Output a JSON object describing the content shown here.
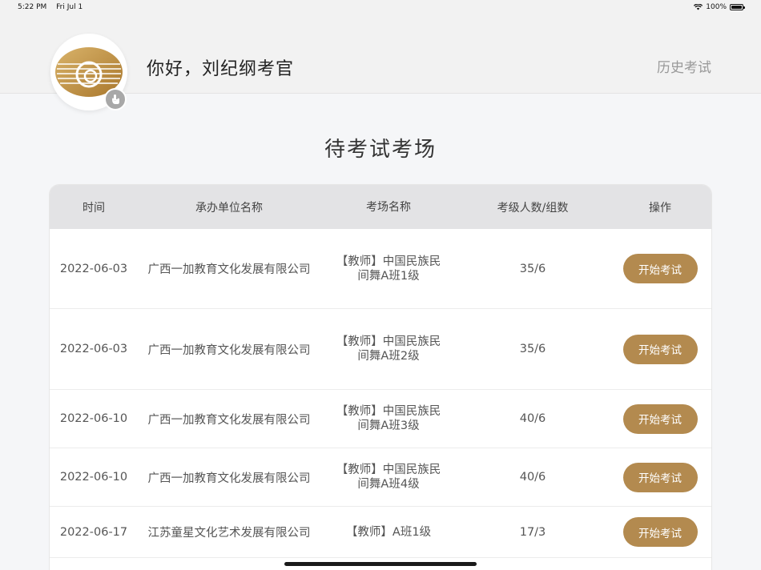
{
  "status": {
    "time": "5:22 PM",
    "date": "Fri Jul 1",
    "battery": "100%"
  },
  "header": {
    "greeting": "你好，刘纪纲考官",
    "history_link": "历史考试"
  },
  "page_title": "待考试考场",
  "table": {
    "columns": [
      "时间",
      "承办单位名称",
      "考场名称",
      "考级人数/组数",
      "操作"
    ],
    "rows": [
      {
        "date": "2022-06-03",
        "org": "广西一加教育文化发展有限公司",
        "venue": "【教师】中国民族民间舞A班1级",
        "count": "35/6",
        "action": "开始考试"
      },
      {
        "date": "2022-06-03",
        "org": "广西一加教育文化发展有限公司",
        "venue": "【教师】中国民族民间舞A班2级",
        "count": "35/6",
        "action": "开始考试"
      },
      {
        "date": "2022-06-10",
        "org": "广西一加教育文化发展有限公司",
        "venue": "【教师】中国民族民间舞A班3级",
        "count": "40/6",
        "action": "开始考试"
      },
      {
        "date": "2022-06-10",
        "org": "广西一加教育文化发展有限公司",
        "venue": "【教师】中国民族民间舞A班4级",
        "count": "40/6",
        "action": "开始考试"
      },
      {
        "date": "2022-06-17",
        "org": "江苏童星文化艺术发展有限公司",
        "venue": "【教师】A班1级",
        "count": "17/3",
        "action": "开始考试"
      }
    ]
  },
  "colors": {
    "accent": "#b38a4f",
    "header_bg": "#f2f2f2",
    "table_head_bg": "#e3e3e5"
  },
  "icons": [
    "wifi-icon",
    "battery-icon",
    "logo-icon",
    "touch-icon"
  ]
}
